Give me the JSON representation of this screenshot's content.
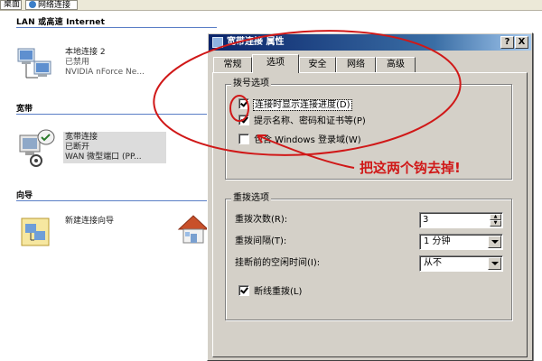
{
  "address_bar": {
    "item_1": "桌面",
    "item_2": "网络连接"
  },
  "background": {
    "section_lan": "LAN 或高速 Internet",
    "lan_connection": {
      "name": "本地连接 2",
      "status": "已禁用",
      "device": "NVIDIA nForce Ne..."
    },
    "section_broadband": "宽带",
    "broadband_connection": {
      "name": "宽带连接",
      "status": "已断开",
      "device": "WAN 微型端口 (PP..."
    },
    "section_wizard": "向导",
    "wizard": {
      "name": "新建连接向导"
    }
  },
  "dialog": {
    "title": "宽带连接 属性",
    "help_button": "?",
    "close_button": "X",
    "tabs": [
      "常规",
      "选项",
      "安全",
      "网络",
      "高级"
    ],
    "active_tab": "选项",
    "dial_group": {
      "title": "拨号选项",
      "show_progress": {
        "label": "连接时显示连接进度(D)",
        "checked": true
      },
      "prompt_credentials": {
        "label": "提示名称、密码和证书等(P)",
        "checked": true
      },
      "include_domain": {
        "label": "包含 Windows 登录域(W)",
        "checked": false
      }
    },
    "redial_group": {
      "title": "重拨选项",
      "attempts_label": "重拨次数(R):",
      "attempts_value": "3",
      "interval_label": "重拨间隔(T):",
      "interval_value": "1 分钟",
      "idle_label": "挂断前的空闲时间(I):",
      "idle_value": "从不",
      "redial_if_dropped": {
        "label": "断线重拨(L)",
        "checked": true
      }
    }
  },
  "annotation": {
    "text": "把这两个钩去掉!",
    "color": "#d01818"
  }
}
